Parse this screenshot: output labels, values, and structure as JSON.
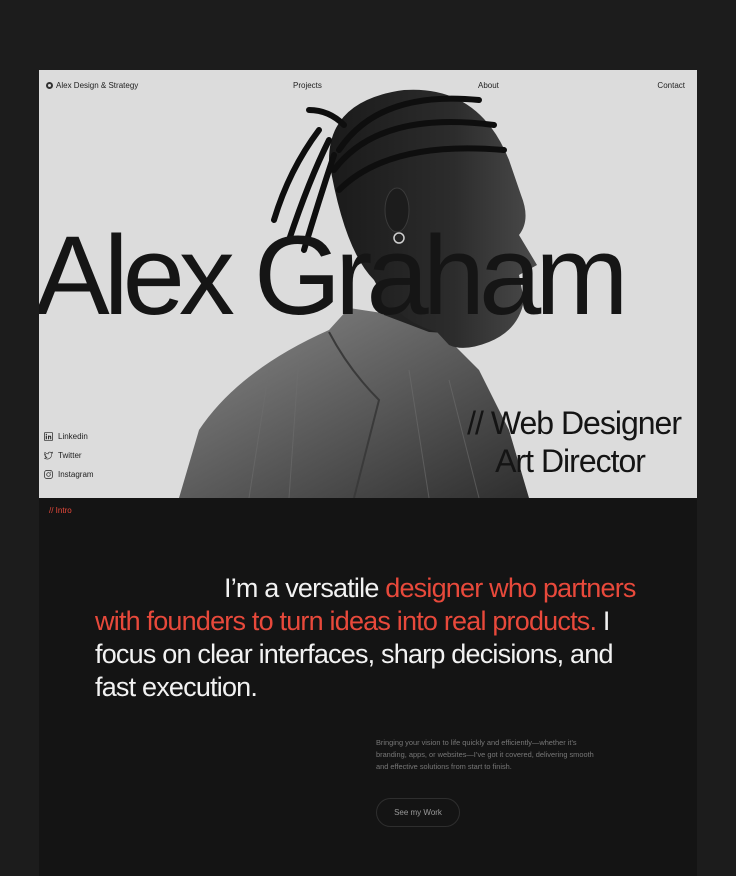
{
  "nav": {
    "brand": "Alex Design & Strategy",
    "projects": "Projects",
    "about": "About",
    "contact": "Contact"
  },
  "hero": {
    "name": "Alex Graham",
    "role_line1": "// Web Designer",
    "role_line2": "Art Director"
  },
  "socials": [
    {
      "label": "Linkedin",
      "icon": "linkedin-icon"
    },
    {
      "label": "Twitter",
      "icon": "twitter-icon"
    },
    {
      "label": "Instagram",
      "icon": "instagram-icon"
    }
  ],
  "intro": {
    "tag": "//  Intro",
    "statement_part1": "I’m a versatile ",
    "statement_accent": "designer who partners with founders to turn ideas into real products.",
    "statement_part2": " I focus on clear interfaces, sharp decisions, and fast execution.",
    "subtext": "Bringing your vision to life quickly and efficiently—whether it’s branding, apps, or websites—I’ve got it covered, delivering smooth and effective solutions from start to finish.",
    "cta_label": "See my Work"
  },
  "colors": {
    "accent": "#e8493b",
    "hero_bg": "#dcdcdc",
    "dark_bg": "#141414",
    "page_bg": "#1c1c1c"
  }
}
